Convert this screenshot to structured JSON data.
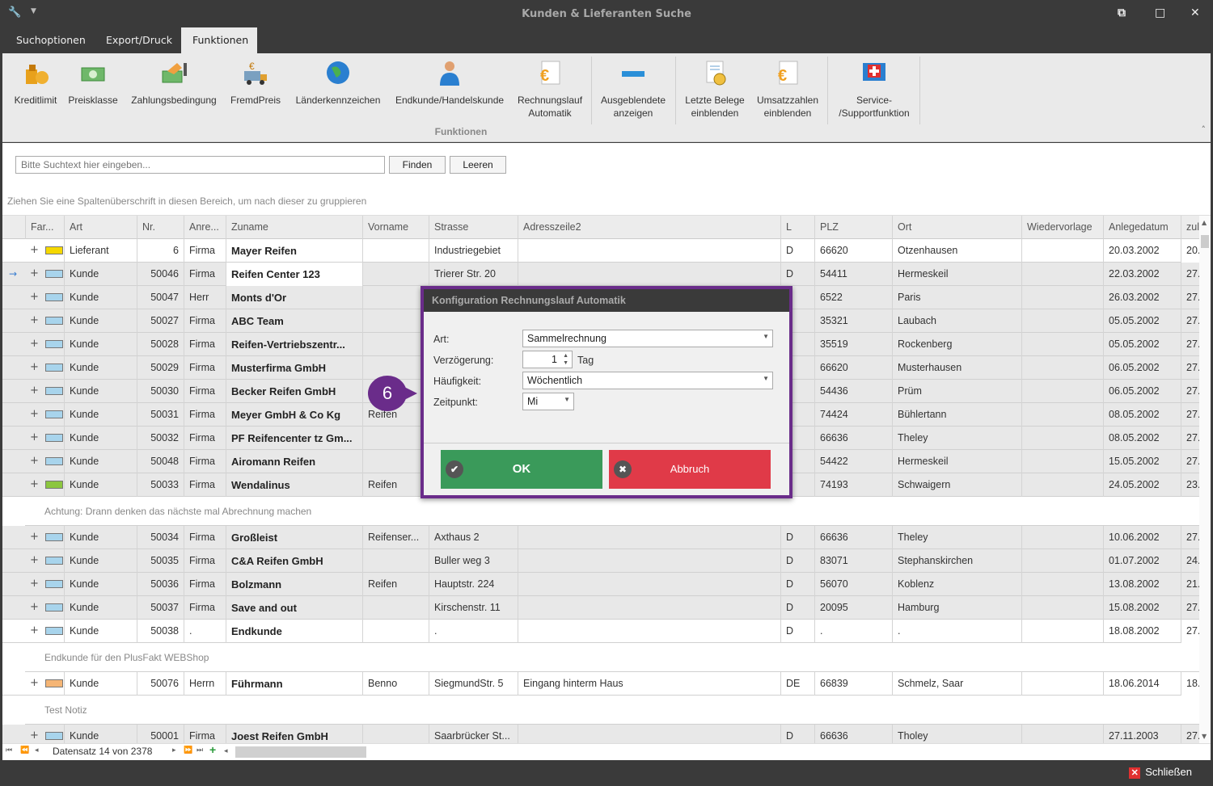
{
  "window": {
    "title": "Kunden & Lieferanten Suche"
  },
  "tabs": [
    "Suchoptionen",
    "Export/Druck",
    "Funktionen"
  ],
  "ribbon": {
    "group_label": "Funktionen",
    "buttons": [
      {
        "label": "Kreditlimit",
        "icon": "credit-limit-icon"
      },
      {
        "label": "Preisklasse",
        "icon": "money-icon"
      },
      {
        "label": "Zahlungsbedingung",
        "icon": "payment-terms-icon"
      },
      {
        "label": "FremdPreis",
        "icon": "truck-euro-icon"
      },
      {
        "label": "Länderkennzeichen",
        "icon": "globe-icon"
      },
      {
        "label": "Endkunde/Handelskunde",
        "icon": "person-icon"
      },
      {
        "label": "Rechnungslauf\nAutomatik",
        "icon": "euro-document-icon"
      },
      {
        "label": "Ausgeblendete\nanzeigen",
        "icon": "minus-icon"
      },
      {
        "label": "Letzte Belege\neinblenden",
        "icon": "document-clock-icon"
      },
      {
        "label": "Umsatzzahlen\neinblenden",
        "icon": "euro-document-icon"
      },
      {
        "label": "Service-\n/Supportfunktion",
        "icon": "support-icon"
      }
    ]
  },
  "search": {
    "placeholder": "Bitte Suchtext hier eingeben...",
    "find_label": "Finden",
    "clear_label": "Leeren"
  },
  "group_hint": "Ziehen Sie eine Spaltenüberschrift in diesen Bereich, um nach dieser zu gruppieren",
  "columns": [
    "Far...",
    "Art",
    "Nr.",
    "Anre...",
    "Zuname",
    "Vorname",
    "Strasse",
    "Adresszeile2",
    "L",
    "PLZ",
    "Ort",
    "Wiedervorlage",
    "Anlegedatum",
    "zuletzt"
  ],
  "rows": [
    {
      "color": "#f5d800",
      "art": "Lieferant",
      "nr": "6",
      "anrede": "Firma",
      "zuname": "Mayer Reifen",
      "vorname": "",
      "strasse": "Industriegebiet",
      "adr2": "",
      "l": "D",
      "plz": "66620",
      "ort": "Otzenhausen",
      "wv": "",
      "anlage": "20.03.2002",
      "zul": "20.",
      "white": true
    },
    {
      "color": "#a8d4ec",
      "art": "Kunde",
      "nr": "50046",
      "anrede": "Firma",
      "zuname": "Reifen Center 123",
      "vorname": "",
      "strasse": "Trierer Str. 20",
      "adr2": "",
      "l": "D",
      "plz": "54411",
      "ort": "Hermeskeil",
      "wv": "",
      "anlage": "22.03.2002",
      "zul": "27.",
      "current": true
    },
    {
      "color": "#a8d4ec",
      "art": "Kunde",
      "nr": "50047",
      "anrede": "Herr",
      "zuname": "Monts d'Or",
      "vorname": "",
      "strasse": "",
      "adr2": "",
      "l": "",
      "plz": "6522",
      "ort": "Paris",
      "wv": "",
      "anlage": "26.03.2002",
      "zul": "27."
    },
    {
      "color": "#a8d4ec",
      "art": "Kunde",
      "nr": "50027",
      "anrede": "Firma",
      "zuname": "ABC Team",
      "vorname": "",
      "strasse": "",
      "adr2": "",
      "l": "",
      "plz": "35321",
      "ort": "Laubach",
      "wv": "",
      "anlage": "05.05.2002",
      "zul": "27."
    },
    {
      "color": "#a8d4ec",
      "art": "Kunde",
      "nr": "50028",
      "anrede": "Firma",
      "zuname": "Reifen-Vertriebszentr...",
      "vorname": "",
      "strasse": "",
      "adr2": "",
      "l": "",
      "plz": "35519",
      "ort": "Rockenberg",
      "wv": "",
      "anlage": "05.05.2002",
      "zul": "27."
    },
    {
      "color": "#a8d4ec",
      "art": "Kunde",
      "nr": "50029",
      "anrede": "Firma",
      "zuname": "Musterfirma GmbH",
      "vorname": "",
      "strasse": "",
      "adr2": "",
      "l": "",
      "plz": "66620",
      "ort": "Musterhausen",
      "wv": "",
      "anlage": "06.05.2002",
      "zul": "27."
    },
    {
      "color": "#a8d4ec",
      "art": "Kunde",
      "nr": "50030",
      "anrede": "Firma",
      "zuname": "Becker Reifen GmbH",
      "vorname": "",
      "strasse": "",
      "adr2": "",
      "l": "",
      "plz": "54436",
      "ort": "Prüm",
      "wv": "",
      "anlage": "06.05.2002",
      "zul": "27."
    },
    {
      "color": "#a8d4ec",
      "art": "Kunde",
      "nr": "50031",
      "anrede": "Firma",
      "zuname": "Meyer GmbH & Co Kg",
      "vorname": "Reifen",
      "strasse": "",
      "adr2": "",
      "l": "",
      "plz": "74424",
      "ort": "Bühlertann",
      "wv": "",
      "anlage": "08.05.2002",
      "zul": "27."
    },
    {
      "color": "#a8d4ec",
      "art": "Kunde",
      "nr": "50032",
      "anrede": "Firma",
      "zuname": "PF Reifencenter tz Gm...",
      "vorname": "",
      "strasse": "",
      "adr2": "",
      "l": "",
      "plz": "66636",
      "ort": "Theley",
      "wv": "",
      "anlage": "08.05.2002",
      "zul": "27."
    },
    {
      "color": "#a8d4ec",
      "art": "Kunde",
      "nr": "50048",
      "anrede": "Firma",
      "zuname": "Airomann Reifen",
      "vorname": "",
      "strasse": "",
      "adr2": "",
      "l": "",
      "plz": "54422",
      "ort": "Hermeskeil",
      "wv": "",
      "anlage": "15.05.2002",
      "zul": "27."
    },
    {
      "color": "#8cc63f",
      "art": "Kunde",
      "nr": "50033",
      "anrede": "Firma",
      "zuname": "Wendalinus",
      "vorname": "Reifen",
      "strasse": "",
      "adr2": "",
      "l": "",
      "plz": "74193",
      "ort": "Schwaigern",
      "wv": "",
      "anlage": "24.05.2002",
      "zul": "23."
    },
    {
      "note": "Achtung: Drann denken das nächste mal Abrechnung machen"
    },
    {
      "color": "#a8d4ec",
      "art": "Kunde",
      "nr": "50034",
      "anrede": "Firma",
      "zuname": "Großleist",
      "vorname": "Reifenser...",
      "strasse": "Axthaus 2",
      "adr2": "",
      "l": "D",
      "plz": "66636",
      "ort": "Theley",
      "wv": "",
      "anlage": "10.06.2002",
      "zul": "27."
    },
    {
      "color": "#a8d4ec",
      "art": "Kunde",
      "nr": "50035",
      "anrede": "Firma",
      "zuname": "C&A Reifen GmbH",
      "vorname": "",
      "strasse": "Buller weg 3",
      "adr2": "",
      "l": "D",
      "plz": "83071",
      "ort": "Stephanskirchen",
      "wv": "",
      "anlage": "01.07.2002",
      "zul": "24."
    },
    {
      "color": "#a8d4ec",
      "art": "Kunde",
      "nr": "50036",
      "anrede": "Firma",
      "zuname": "Bolzmann",
      "vorname": "Reifen",
      "strasse": "Hauptstr. 224",
      "adr2": "",
      "l": "D",
      "plz": "56070",
      "ort": "Koblenz",
      "wv": "",
      "anlage": "13.08.2002",
      "zul": "21."
    },
    {
      "color": "#a8d4ec",
      "art": "Kunde",
      "nr": "50037",
      "anrede": "Firma",
      "zuname": "Save and out",
      "vorname": "",
      "strasse": "Kirschenstr. 11",
      "adr2": "",
      "l": "D",
      "plz": "20095",
      "ort": "Hamburg",
      "wv": "",
      "anlage": "15.08.2002",
      "zul": "27."
    },
    {
      "color": "#a8d4ec",
      "art": "Kunde",
      "nr": "50038",
      "anrede": ".",
      "zuname": "Endkunde",
      "vorname": "",
      "strasse": ".",
      "adr2": "",
      "l": "D",
      "plz": ".",
      "ort": ".",
      "wv": "",
      "anlage": "18.08.2002",
      "zul": "27.",
      "white": true
    },
    {
      "note": "Endkunde für den PlusFakt WEBShop"
    },
    {
      "color": "#f5b575",
      "art": "Kunde",
      "nr": "50076",
      "anrede": "Herrn",
      "zuname": "Führmann",
      "vorname": "Benno",
      "strasse": "SiegmundStr. 5",
      "adr2": "Eingang hinterm Haus",
      "l": "DE",
      "plz": "66839",
      "ort": "Schmelz, Saar",
      "wv": "",
      "anlage": "18.06.2014",
      "zul": "18.",
      "white": true
    },
    {
      "note": "Test Notiz"
    },
    {
      "color": "#a8d4ec",
      "art": "Kunde",
      "nr": "50001",
      "anrede": "Firma",
      "zuname": "Joest Reifen GmbH",
      "vorname": "",
      "strasse": "Saarbrücker St...",
      "adr2": "",
      "l": "D",
      "plz": "66636",
      "ort": "Tholey",
      "wv": "",
      "anlage": "27.11.2003",
      "zul": "27."
    }
  ],
  "navigator": {
    "record_text": "Datensatz 14 von 2378"
  },
  "status": {
    "close_label": "Schließen"
  },
  "dialog": {
    "title": "Konfiguration Rechnungslauf Automatik",
    "art_label": "Art:",
    "art_value": "Sammelrechnung",
    "delay_label": "Verzögerung:",
    "delay_value": "1",
    "delay_unit": "Tag",
    "freq_label": "Häufigkeit:",
    "freq_value": "Wöchentlich",
    "time_label": "Zeitpunkt:",
    "time_value": "Mi",
    "ok_label": "OK",
    "cancel_label": "Abbruch"
  },
  "callout": "6"
}
